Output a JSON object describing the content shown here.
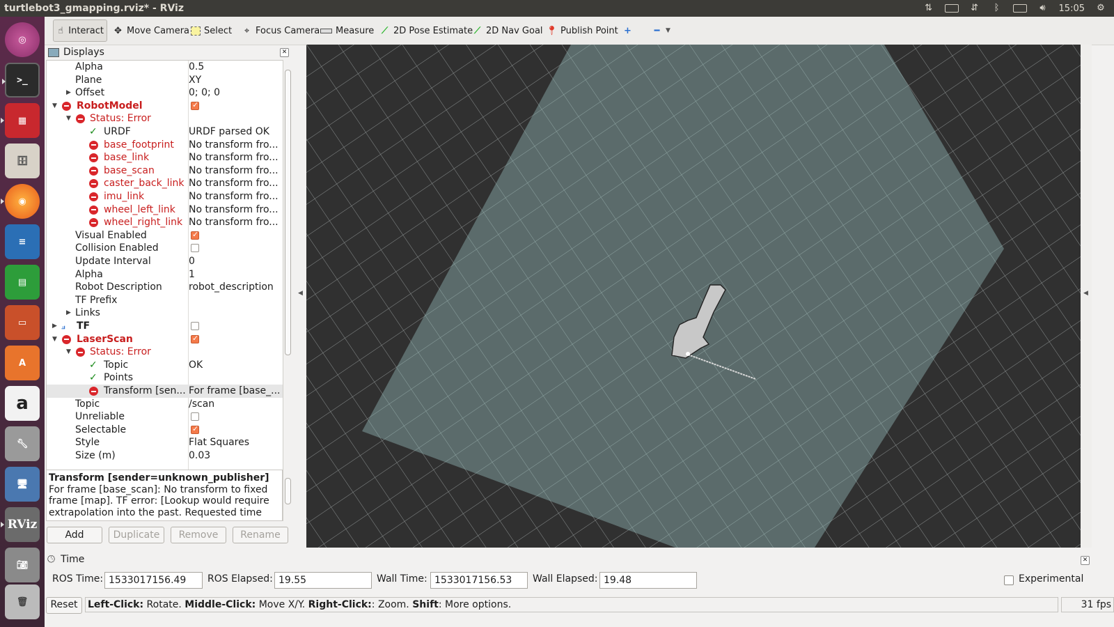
{
  "window": {
    "title": "turtlebot3_gmapping.rviz* - RViz",
    "clock": "15:05"
  },
  "launcher": {
    "rviz_label": "RViz"
  },
  "toolbar": {
    "interact": "Interact",
    "move_camera": "Move Camera",
    "select": "Select",
    "focus_camera": "Focus Camera",
    "measure": "Measure",
    "pose_estimate": "2D Pose Estimate",
    "nav_goal": "2D Nav Goal",
    "publish_point": "Publish Point"
  },
  "displays": {
    "title": "Displays",
    "rows": [
      {
        "label": "Alpha",
        "value": "0.5"
      },
      {
        "label": "Plane",
        "value": "XY"
      },
      {
        "label": "Offset",
        "value": "0; 0; 0"
      },
      {
        "label": "RobotModel",
        "value": ""
      },
      {
        "label": "Status: Error",
        "value": ""
      },
      {
        "label": "URDF",
        "value": "URDF parsed OK"
      },
      {
        "label": "base_footprint",
        "value": "No transform fro..."
      },
      {
        "label": "base_link",
        "value": "No transform fro..."
      },
      {
        "label": "base_scan",
        "value": "No transform fro..."
      },
      {
        "label": "caster_back_link",
        "value": "No transform fro..."
      },
      {
        "label": "imu_link",
        "value": "No transform fro..."
      },
      {
        "label": "wheel_left_link",
        "value": "No transform fro..."
      },
      {
        "label": "wheel_right_link",
        "value": "No transform fro..."
      },
      {
        "label": "Visual Enabled",
        "value": ""
      },
      {
        "label": "Collision Enabled",
        "value": ""
      },
      {
        "label": "Update Interval",
        "value": "0"
      },
      {
        "label": "Alpha",
        "value": "1"
      },
      {
        "label": "Robot Description",
        "value": "robot_description"
      },
      {
        "label": "TF Prefix",
        "value": ""
      },
      {
        "label": "Links",
        "value": ""
      },
      {
        "label": "TF",
        "value": ""
      },
      {
        "label": "LaserScan",
        "value": ""
      },
      {
        "label": "Status: Error",
        "value": ""
      },
      {
        "label": "Topic",
        "value": "OK"
      },
      {
        "label": "Points",
        "value": ""
      },
      {
        "label": "Transform [sen...",
        "value": "For frame [base_..."
      },
      {
        "label": "Topic",
        "value": "/scan"
      },
      {
        "label": "Unreliable",
        "value": ""
      },
      {
        "label": "Selectable",
        "value": ""
      },
      {
        "label": "Style",
        "value": "Flat Squares"
      },
      {
        "label": "Size (m)",
        "value": "0.03"
      }
    ],
    "description": {
      "heading": "Transform [sender=unknown_publisher]",
      "body": "For frame [base_scan]: No transform to fixed frame [map]. TF error: [Lookup would require extrapolation into the past. Requested time"
    },
    "buttons": {
      "add": "Add",
      "duplicate": "Duplicate",
      "remove": "Remove",
      "rename": "Rename"
    }
  },
  "time": {
    "title": "Time",
    "ros_time_label": "ROS Time:",
    "ros_time": "1533017156.49",
    "ros_elapsed_label": "ROS Elapsed:",
    "ros_elapsed": "19.55",
    "wall_time_label": "Wall Time:",
    "wall_time": "1533017156.53",
    "wall_elapsed_label": "Wall Elapsed:",
    "wall_elapsed": "19.48",
    "experimental_label": "Experimental"
  },
  "status": {
    "reset": "Reset",
    "left_click": "Left-Click:",
    "left_click_desc": " Rotate. ",
    "middle_click": "Middle-Click:",
    "middle_click_desc": " Move X/Y. ",
    "right_click": "Right-Click:",
    "right_click_desc": ": Zoom. ",
    "shift": "Shift",
    "shift_desc": ": More options.",
    "fps": "31 fps"
  },
  "colors": {
    "error": "#c81e1e",
    "ok": "#1a8a1a",
    "map_free": "#5b6b6b",
    "background": "#303030",
    "checkbox_on": "#f47a4a"
  }
}
